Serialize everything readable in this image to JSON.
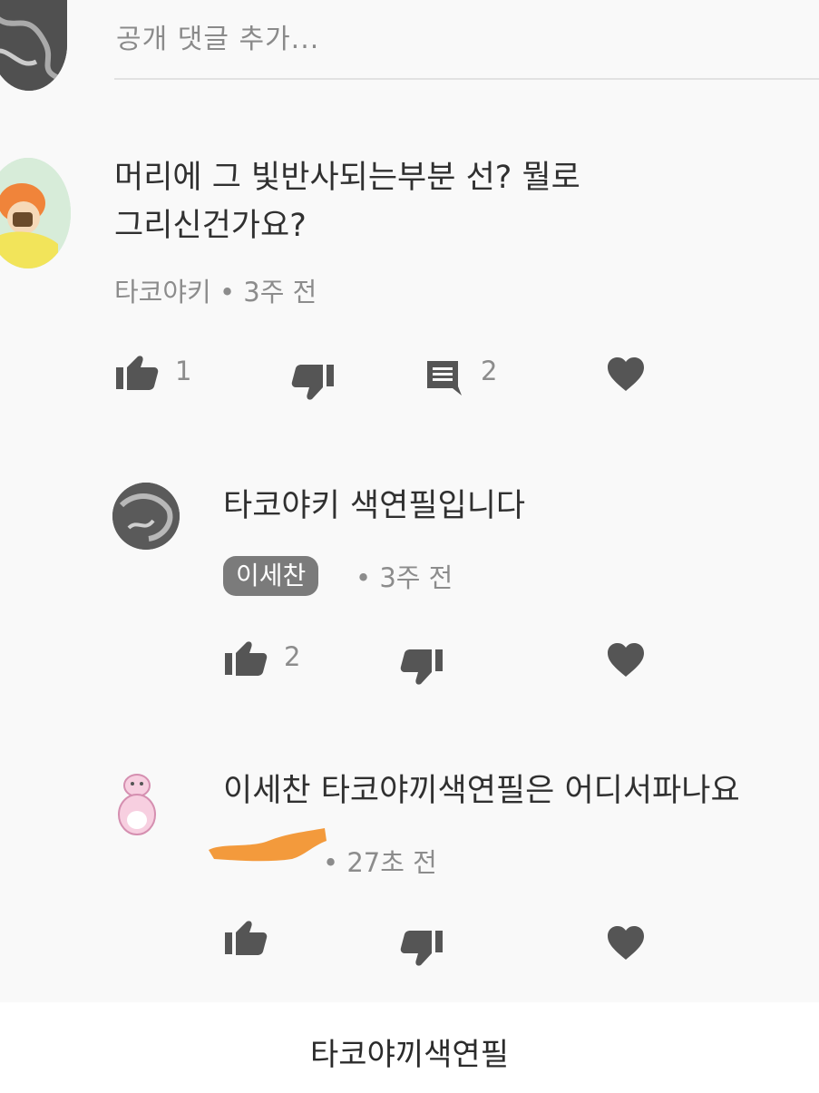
{
  "top_comment": {
    "text": "공개 댓글 추가..."
  },
  "comment1": {
    "text_line1": "머리에 그 빛반사되는부분 선? 뭘로",
    "text_line2": "그리신건가요?",
    "author": "타코야키",
    "time": "3주 전",
    "likes": "1",
    "replies": "2"
  },
  "reply1": {
    "text": "타코야키 색연필입니다",
    "author_badge": "이세찬",
    "time": "3주 전",
    "likes": "2"
  },
  "reply2": {
    "text": "이세찬 타코야끼색연필은 어디서파나요",
    "time": "27초 전"
  },
  "caption": "타코야끼색연필",
  "colors": {
    "icon": "#555555",
    "badge": "#7b7b7b",
    "redaction": "#f39a3c"
  },
  "icons": [
    "thumb-up-icon",
    "thumb-down-icon",
    "comment-icon",
    "heart-icon"
  ]
}
